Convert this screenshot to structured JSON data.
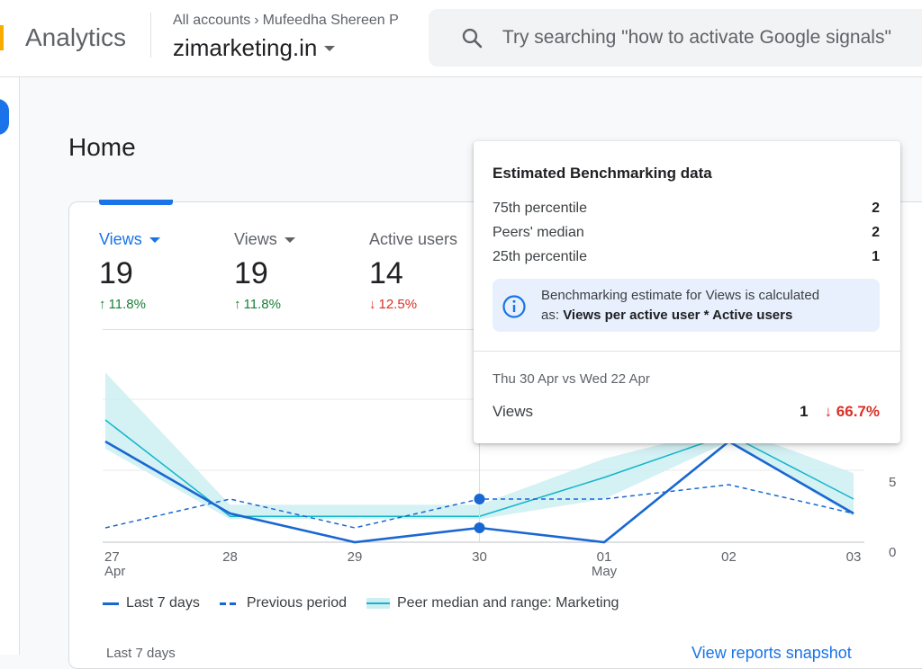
{
  "header": {
    "app_name": "Analytics",
    "breadcrumb_root": "All accounts",
    "breadcrumb_account": "Mufeedha Shereen P",
    "property": "zimarketing.in",
    "search_placeholder": "Try searching \"how to activate Google signals\""
  },
  "page": {
    "title": "Home"
  },
  "metrics": [
    {
      "label": "Views",
      "value": "19",
      "delta": "11.8%",
      "direction": "up"
    },
    {
      "label": "Views",
      "value": "19",
      "delta": "11.8%",
      "direction": "up"
    },
    {
      "label": "Active users",
      "value": "14",
      "delta": "12.5%",
      "direction": "down"
    }
  ],
  "chart_data": {
    "type": "line",
    "x": [
      "27 Apr",
      "28",
      "29",
      "30",
      "01 May",
      "02",
      "03"
    ],
    "x_ticks": [
      {
        "line1": "27",
        "line2": "Apr"
      },
      {
        "line1": "28",
        "line2": ""
      },
      {
        "line1": "29",
        "line2": ""
      },
      {
        "line1": "30",
        "line2": ""
      },
      {
        "line1": "01",
        "line2": "May"
      },
      {
        "line1": "02",
        "line2": ""
      },
      {
        "line1": "03",
        "line2": ""
      }
    ],
    "y_ticks": [
      "5",
      "0"
    ],
    "ylim": [
      0,
      10
    ],
    "series": [
      {
        "name": "Last 7 days",
        "values": [
          7,
          2,
          0,
          1,
          0,
          7,
          2
        ],
        "style": "solid",
        "color": "#1967d2"
      },
      {
        "name": "Previous period",
        "values": [
          1,
          3,
          1,
          3,
          3,
          4,
          2
        ],
        "style": "dashed",
        "color": "#1967d2"
      },
      {
        "name": "Peer median and range: Marketing",
        "values": [
          8.5,
          1.8,
          1.8,
          1.8,
          4.5,
          7.5,
          3
        ],
        "low": [
          6.5,
          1.6,
          1.6,
          1.6,
          3.0,
          7.0,
          1.8
        ],
        "high": [
          11.8,
          2.6,
          2.6,
          2.6,
          5.8,
          8.0,
          4.8
        ],
        "style": "band",
        "color": "#12b5cb"
      }
    ]
  },
  "tooltip": {
    "title": "Estimated Benchmarking data",
    "rows": [
      {
        "label": "75th percentile",
        "value": "2"
      },
      {
        "label": "Peers' median",
        "value": "2"
      },
      {
        "label": "25th percentile",
        "value": "1"
      }
    ],
    "info_line1": "Benchmarking estimate for Views is calculated",
    "info_line2_prefix": "as:",
    "info_line2_bold": "Views per active user * Active users",
    "date_compare": "Thu 30 Apr vs Wed 22 Apr",
    "views_label": "Views",
    "views_value": "1",
    "views_change": "66.7%"
  },
  "footer": {
    "left_text": "Last 7 days",
    "right_link": "View reports snapshot"
  }
}
